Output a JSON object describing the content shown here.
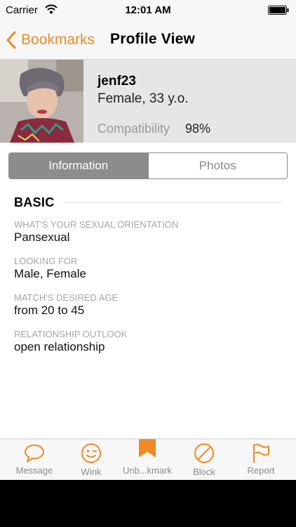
{
  "status_bar": {
    "carrier": "Carrier",
    "time": "12:01 AM"
  },
  "nav": {
    "back_label": "Bookmarks",
    "title": "Profile View"
  },
  "profile": {
    "username": "jenf23",
    "gender_age": "Female, 33 y.o.",
    "compatibility_label": "Compatibility",
    "compatibility_value": "98%"
  },
  "segments": {
    "information": "Information",
    "photos": "Photos",
    "selected": "Information"
  },
  "section": {
    "title": "BASIC"
  },
  "fields": [
    {
      "label": "WHAT'S YOUR SEXUAL ORIENTATION",
      "value": "Pansexual"
    },
    {
      "label": "LOOKING FOR",
      "value": "Male, Female"
    },
    {
      "label": "MATCH'S DESIRED AGE",
      "value": "from 20 to 45"
    },
    {
      "label": "RELATIONSHIP OUTLOOK",
      "value": "open relationship"
    }
  ],
  "tabs": [
    {
      "label": "Message",
      "icon": "chat-bubble-icon"
    },
    {
      "label": "Wink",
      "icon": "wink-face-icon"
    },
    {
      "label": "Unb...kmark",
      "icon": "bookmark-icon"
    },
    {
      "label": "Block",
      "icon": "block-icon"
    },
    {
      "label": "Report",
      "icon": "flag-icon"
    }
  ],
  "colors": {
    "accent": "#f08a24",
    "segment_active": "#8c8c8c",
    "header_bg": "#e6e6e6",
    "muted_text": "#a6a6a6"
  }
}
